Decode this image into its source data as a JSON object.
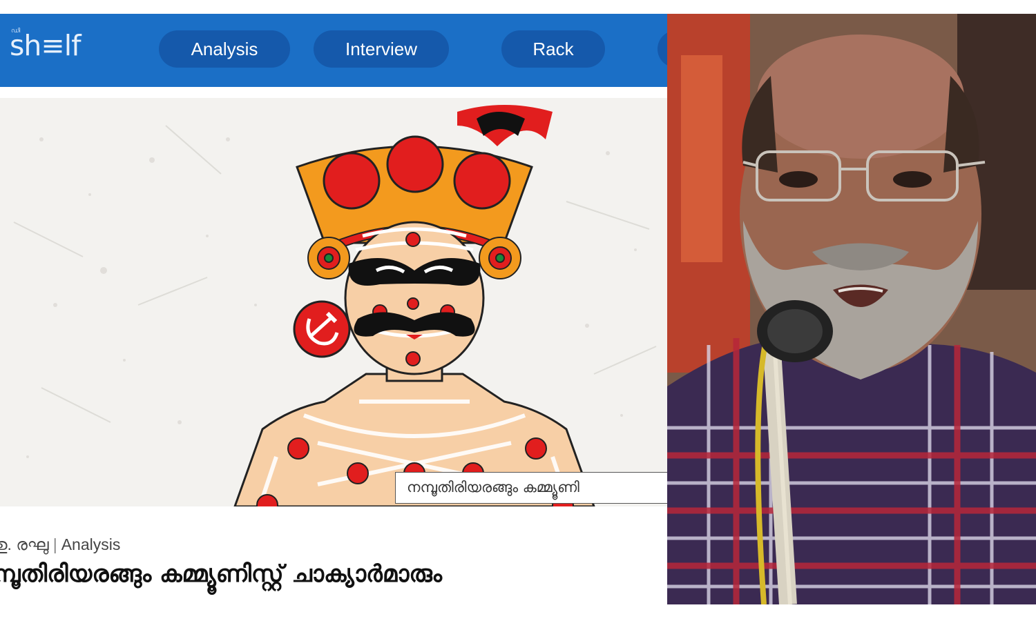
{
  "site": {
    "logo_small": "ഡി",
    "logo_text": "sh≡lf"
  },
  "nav": {
    "tabs": [
      {
        "label": "Analysis"
      },
      {
        "label": "Interview"
      },
      {
        "label": "Rack"
      },
      {
        "label": ""
      }
    ]
  },
  "hero": {
    "caption": "നമ്പൂതിരിയരങ്ങും കമ്മ്യൂണി"
  },
  "article": {
    "author": "ഉ. രഘു",
    "category": "Analysis",
    "separator": "|",
    "title": "മ്പൂതിരിയരങ്ങും കമ്മ്യൂണിസ്റ്റ് ചാക്യാർമാരും"
  },
  "colors": {
    "nav_bg": "#1b6fc6",
    "tab_bg": "#1559ab",
    "theyyam_red": "#e11e1e",
    "crown_orange": "#f39a1e",
    "skin": "#f7cfa6"
  },
  "icons": {
    "hammer_sickle": "hammer-and-sickle-emblem"
  }
}
